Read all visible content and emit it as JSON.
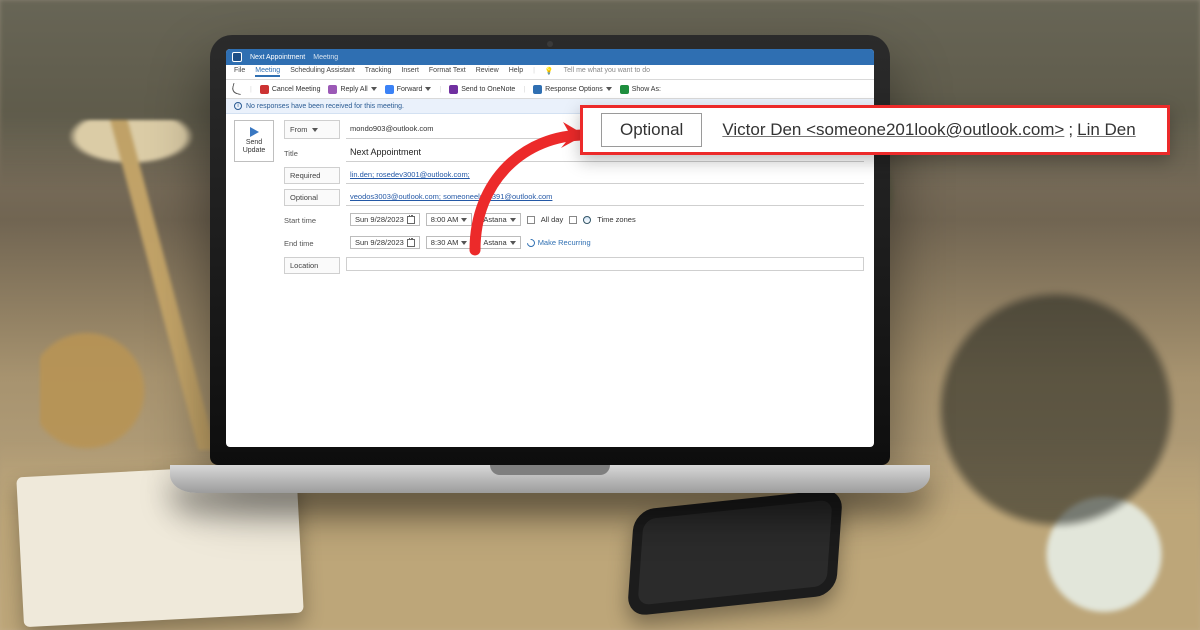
{
  "titlebar": {
    "doc_title": "Next Appointment",
    "context": "Meeting"
  },
  "menubar": {
    "items": [
      "File",
      "Meeting",
      "Scheduling Assistant",
      "Tracking",
      "Insert",
      "Format Text",
      "Review",
      "Help"
    ],
    "tell_me": "Tell me what you want to do"
  },
  "ribbon": {
    "cancel": "Cancel Meeting",
    "reply_all": "Reply All",
    "forward": "Forward",
    "onenote": "Send to OneNote",
    "response": "Response Options",
    "show_as": "Show As:"
  },
  "infobar": {
    "text": "No responses have been received for this meeting."
  },
  "form": {
    "send_label": "Send Update",
    "from_label": "From",
    "from_value": "mondo903@outlook.com",
    "title_label": "Title",
    "title_value": "Next Appointment",
    "required_label": "Required",
    "required_value": "lin.den; rosedev3001@outlook.com;",
    "optional_label": "Optional",
    "optional_value": "veodos3003@outlook.com; someoneelse4391@outlook.com",
    "start_label": "Start time",
    "start_date": "Sun 9/28/2023",
    "start_time": "8:00 AM",
    "start_tz": "Astana",
    "allday": "All day",
    "timezones": "Time zones",
    "end_label": "End time",
    "end_date": "Sun 9/28/2023",
    "end_time": "8:30 AM",
    "end_tz": "Astana",
    "recurring": "Make Recurring",
    "location_label": "Location"
  },
  "callout": {
    "button": "Optional",
    "recipient1": "Victor Den <someone201look@outlook.com>",
    "sep": "; ",
    "recipient2": "Lin Den"
  }
}
